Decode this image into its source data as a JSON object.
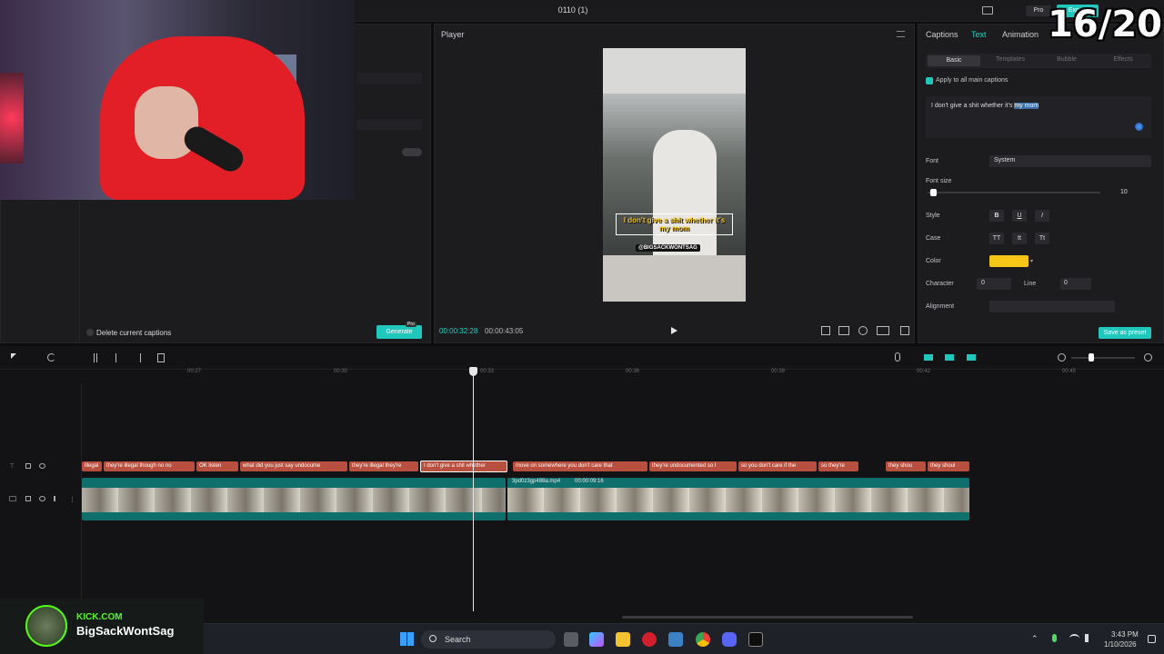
{
  "app": {
    "title": "0110 (1)",
    "pro_label": "Pro",
    "export_label": "Export"
  },
  "overlay": {
    "counter": "16/20"
  },
  "left_panel": {
    "delete_captions_label": "Delete current captions",
    "generate_label": "Generate",
    "pro_badge": "Pro"
  },
  "player": {
    "title": "Player",
    "caption_line": "I don't give a shit whether it's my mom",
    "watermark": "@BIGSACKWONTSAG",
    "current_time": "00:00:32:28",
    "total_time": "00:00:43:05"
  },
  "right_panel": {
    "tabs": [
      "Captions",
      "Text",
      "Animation"
    ],
    "active_tab": "Text",
    "subtabs": [
      "Basic",
      "Templates",
      "Bubble",
      "Effects"
    ],
    "active_subtab": "Basic",
    "apply_all_label": "Apply to all main captions",
    "caption_text": "I don't give a shit whether it's",
    "caption_text_selected": "my mom",
    "font_label": "Font",
    "font_value": "System",
    "font_size_label": "Font size",
    "font_size_value": "10",
    "font_size_fraction": 0.02,
    "style_label": "Style",
    "style_buttons": [
      "B",
      "U",
      "I"
    ],
    "case_label": "Case",
    "case_buttons": [
      "TT",
      "tt",
      "Tt"
    ],
    "color_label": "Color",
    "color_value": "#f5c518",
    "character_label": "Character",
    "character_value": "0",
    "line_label": "Line",
    "line_value": "0",
    "alignment_label": "Alignment",
    "save_preset_label": "Save as preset"
  },
  "timeline": {
    "ruler": [
      "00:27",
      "00:30",
      "00:33",
      "00:36",
      "00:39",
      "00:42",
      "00:45"
    ],
    "captions": [
      {
        "text": "illegal"
      },
      {
        "text": "they're illegal though no no"
      },
      {
        "text": "OK listen"
      },
      {
        "text": "what did you just say undocume"
      },
      {
        "text": "they're illegal they're"
      },
      {
        "text": "I don't give a shit whether"
      },
      {
        "text": "move on somewhere you don't care that"
      },
      {
        "text": "they're undocumented so I"
      },
      {
        "text": "so you don't care if the"
      },
      {
        "text": "so they're"
      },
      {
        "text": "they shou"
      },
      {
        "text": "they shoul"
      }
    ],
    "caption_icon": "AI",
    "video_clip_label": "3pd0z3gp488a.mp4",
    "video_clip_duration": "00:00:09:16",
    "accent": "#1fc7bd"
  },
  "taskbar": {
    "search_label": "Search",
    "time": "3:43 PM",
    "date": "1/10/2026"
  },
  "streamer": {
    "site": "KICK.COM",
    "name": "BigSackWontSag"
  }
}
